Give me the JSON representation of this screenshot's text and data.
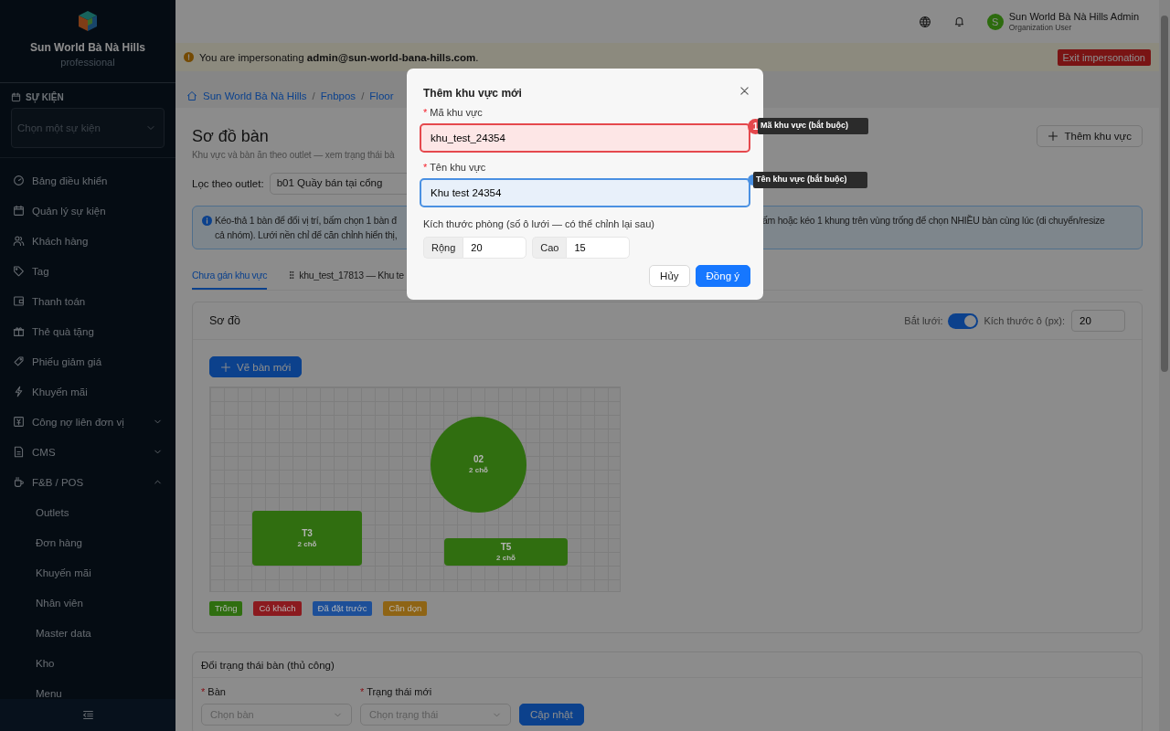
{
  "sidebar": {
    "brand": {
      "name": "Sun World Bà Nà Hills",
      "plan": "professional"
    },
    "event_section": {
      "title": "SỰ KIỆN",
      "select": {
        "placeholder": "Chọn một sự kiện"
      }
    },
    "items": [
      {
        "label": "Bảng điều khiển",
        "selected": false
      },
      {
        "label": "Quản lý sự kiện",
        "selected": false
      },
      {
        "label": "Khách hàng",
        "selected": false
      },
      {
        "label": "Tag",
        "selected": false
      },
      {
        "label": "Thanh toán",
        "selected": false
      },
      {
        "label": "Thẻ quà tặng",
        "selected": false
      },
      {
        "label": "Phiếu giảm giá",
        "selected": false
      },
      {
        "label": "Khuyến mãi",
        "selected": false
      },
      {
        "label": "Công nợ liên đơn vị",
        "selected": false,
        "expanded": false
      },
      {
        "label": "CMS",
        "selected": false,
        "expanded": false
      },
      {
        "label": "F&B / POS",
        "selected": false,
        "expanded": true,
        "children": [
          {
            "label": "Outlets",
            "selected": false
          },
          {
            "label": "Đơn hàng",
            "selected": false
          },
          {
            "label": "Khuyến mãi",
            "selected": false
          },
          {
            "label": "Nhân viên",
            "selected": false
          },
          {
            "label": "Master data",
            "selected": false
          },
          {
            "label": "Kho",
            "selected": false
          },
          {
            "label": "Menu",
            "selected": false
          }
        ]
      }
    ]
  },
  "header": {
    "user": {
      "initial": "S",
      "name": "Sun World Bà Nà Hills Admin",
      "role": "Organization User"
    }
  },
  "banner": {
    "text": "You are impersonating **admin@sun-world-bana-hills.com**.",
    "button": "Exit impersonation"
  },
  "breadcrumb": {
    "separator": "/",
    "items": [
      "Sun World Bà Nà Hills",
      "Fnbpos",
      "Floor"
    ]
  },
  "page": {
    "title": "Sơ đồ bàn",
    "subtitle": "Khu vực và bàn ăn theo outlet — xem trạng thái bà",
    "add_button": "Thêm khu vực",
    "filter": {
      "label": "Lọc theo outlet:",
      "value": "b01 Quầy bán tại cổng"
    },
    "alert": [
      "Kéo-thả 1 bàn để đổi vị trí, bấm chọn 1 bàn đ",
      "ấm hoặc kéo 1 khung trên vùng trống để chọn NHIỀU bàn cùng lúc (di chuyển/resize",
      "cả nhóm). Lưới nền chỉ để căn chỉnh hiển thị,"
    ],
    "tabs": [
      {
        "label": "Chưa gán khu vực",
        "selected": true
      },
      {
        "label": "khu_test_17813 — Khu te",
        "selected": false
      }
    ]
  },
  "diagram": {
    "title": "Sơ đồ",
    "snap_label": "Bắt lưới:",
    "snap_to_grid": true,
    "cell_label": "Kích thước ô (px):",
    "cell_size": "20",
    "draw_button": "Vẽ bàn mới",
    "tables": [
      {
        "name": "02",
        "seats": "2 chỗ",
        "kind": "circle",
        "color": "#306e10"
      },
      {
        "name": "T3",
        "seats": "2 chỗ",
        "kind": "rect",
        "color": "#306e10"
      },
      {
        "name": "T5",
        "seats": "2 chỗ",
        "kind": "rect",
        "color": "#306e10"
      }
    ],
    "legend": [
      {
        "label": "Trống",
        "color": "#2f6e10"
      },
      {
        "label": "Có khách",
        "color": "#8b1a1f"
      },
      {
        "label": "Đã đặt trước",
        "color": "#1d4f98"
      },
      {
        "label": "Cần dọn",
        "color": "#8e6415"
      }
    ]
  },
  "status_form": {
    "title": "Đổi trạng thái bàn (thủ công)",
    "fields": [
      {
        "marker": "*",
        "label": "Bàn",
        "placeholder": "Chọn bàn"
      },
      {
        "marker": "*",
        "label": "Trạng thái mới",
        "placeholder": "Chọn trạng thái"
      }
    ],
    "button": "Cập nhật"
  },
  "modal": {
    "title": "Thêm khu vực mới",
    "fields": [
      {
        "marker": "*",
        "label": "Mã khu vực",
        "value": "khu_test_24354",
        "error": true,
        "focused": false
      },
      {
        "marker": "*",
        "label": "Tên khu vực",
        "value": "Khu test 24354",
        "error": false,
        "focused": true
      }
    ],
    "size_label": "Kích thước phòng (số ô lưới — có thể chỉnh lại sau)",
    "size_fields": [
      {
        "addon": "Rộng",
        "value": "20"
      },
      {
        "addon": "Cao",
        "value": "15"
      }
    ],
    "buttons": [
      {
        "label": "Hủy",
        "kind": "default"
      },
      {
        "label": "Đồng ý",
        "kind": "primary"
      }
    ]
  },
  "hints": [
    {
      "badge": "1",
      "label": "Mã khu vực (bắt buộc)",
      "kind": "error"
    },
    {
      "label": "Tên khu vực (bắt buộc)",
      "kind": "info"
    }
  ]
}
